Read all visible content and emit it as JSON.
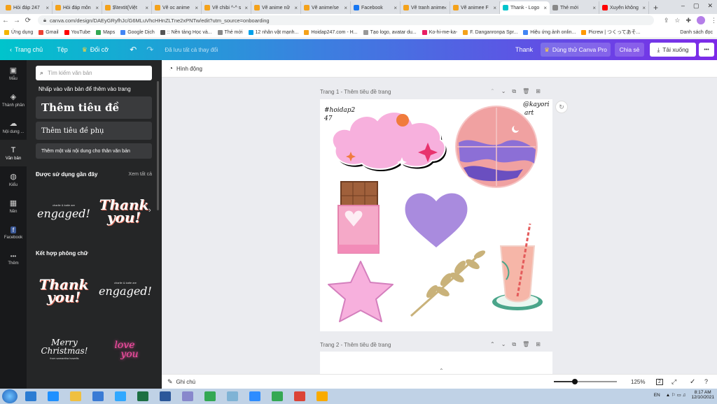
{
  "browser": {
    "tabs": [
      {
        "label": "Hỏi đáp 247",
        "color": "#f4a21a"
      },
      {
        "label": "Hỏi đáp môn",
        "color": "#f4a21a"
      },
      {
        "label": "$\\textit{Việt",
        "color": "#f4a21a"
      },
      {
        "label": "Vẽ oc anime",
        "color": "#f4a21a"
      },
      {
        "label": "Vẽ chibi ^-^ s",
        "color": "#f4a21a"
      },
      {
        "label": "Vẽ anime nữ",
        "color": "#f4a21a"
      },
      {
        "label": "Vẽ anime/se",
        "color": "#f4a21a"
      },
      {
        "label": "Facebook",
        "color": "#1877f2"
      },
      {
        "label": "Vẽ tranh anime",
        "color": "#f4a21a"
      },
      {
        "label": "Vẽ animee F",
        "color": "#f4a21a"
      },
      {
        "label": "Thank - Logo",
        "color": "#00c4cc",
        "active": true
      },
      {
        "label": "Thẻ mới",
        "color": "#888888"
      },
      {
        "label": "Xuyên không",
        "color": "#ff0000"
      }
    ],
    "new_tab": "+",
    "url": "canva.com/design/DAEyGRyfhJc/G6MLuVhcHHnZLTne2xPNTw/edit?utm_source=onboarding",
    "bookmarks": [
      {
        "label": "Ứng dụng",
        "color": "#f4b400"
      },
      {
        "label": "Gmail",
        "color": "#ea4335"
      },
      {
        "label": "YouTube",
        "color": "#ff0000"
      },
      {
        "label": "Maps",
        "color": "#34a853"
      },
      {
        "label": "Google Dịch",
        "color": "#4285f4"
      },
      {
        "label": ":: Nền tảng Học và...",
        "color": "#555555"
      },
      {
        "label": "Thẻ mới",
        "color": "#888888"
      },
      {
        "label": "12 nhân vật mạnh...",
        "color": "#00a0e9"
      },
      {
        "label": "Hoidap247.com - H...",
        "color": "#f4a21a"
      },
      {
        "label": "Tạo logo, avatar du...",
        "color": "#999999"
      },
      {
        "label": "Ko-hi-me-ka-",
        "color": "#e91e63"
      },
      {
        "label": "F. Danganronpa Spr...",
        "color": "#f4a21a"
      },
      {
        "label": "Hiệu ứng ảnh onlin...",
        "color": "#4285f4"
      },
      {
        "label": "Picrew | つくってあそ...",
        "color": "#ff9800"
      }
    ],
    "reading_list": "Danh sách đọc"
  },
  "header": {
    "home": "Trang chủ",
    "file": "Tệp",
    "resize": "Đổi cỡ",
    "saved": "Đã lưu tất cả thay đổi",
    "title": "Thank",
    "try_pro": "Dùng thử Canva Pro",
    "share": "Chia sẻ",
    "download": "Tải xuống",
    "more": "•••"
  },
  "rail": [
    {
      "label": "Mẫu",
      "icon": "template-icon"
    },
    {
      "label": "Thành phần",
      "icon": "elements-icon"
    },
    {
      "label": "Nội dung ...",
      "icon": "upload-icon"
    },
    {
      "label": "Văn bản",
      "icon": "text-icon",
      "active": true
    },
    {
      "label": "Kiểu",
      "icon": "styles-icon"
    },
    {
      "label": "Nền",
      "icon": "background-icon"
    },
    {
      "label": "Facebook",
      "icon": "facebook-icon"
    },
    {
      "label": "Thêm",
      "icon": "more-icon"
    }
  ],
  "panel": {
    "search_placeholder": "Tìm kiếm văn bản",
    "hint": "Nhấp vào văn bản để thêm vào trang",
    "heading": "Thêm tiêu đề",
    "subheading": "Thêm tiêu đề phụ",
    "body": "Thêm một vài nội dung cho thân văn bản",
    "recent_title": "Được sử dụng gần đây",
    "see_all": "Xem tất cả",
    "combo_title": "Kết hợp phông chữ",
    "thumbs": {
      "charlie": "charlie & katie are",
      "engaged": "engaged!",
      "thank": "Thank",
      "you": "you!",
      "merry": "Merry",
      "christmas": "Christmas!",
      "from": "from samantha howells",
      "love": "love",
      "you2": "you"
    }
  },
  "editor": {
    "animate": "Hình động",
    "page1_label": "Trang 1 - Thêm tiêu đề trang",
    "page2_label": "Trang 2 - Thêm tiêu đề trang",
    "sticker_left": "#hoidap2\n47",
    "sticker_right": "@kayori\nart"
  },
  "footer": {
    "notes": "Ghi chú",
    "zoom": "125%",
    "page_count": "2",
    "zoom_level": 0.33
  },
  "taskbar": {
    "lang": "EN",
    "time": "8:17 AM",
    "date": "12/10/2021",
    "apps": [
      "#2b7cd3",
      "#1e90ff",
      "#f0c040",
      "#3a7bd5",
      "#31a8ff",
      "#1d6f42",
      "#2b579a",
      "#8888cc",
      "#34a853",
      "#7fb3d5",
      "#2d8cff",
      "#34a853",
      "#db4437",
      "#f9ab00"
    ]
  },
  "colors": {
    "accent_purple": "#7d2ae8",
    "accent_teal": "#00c4cc",
    "panel_bg": "#252627",
    "rail_bg": "#18191b"
  }
}
